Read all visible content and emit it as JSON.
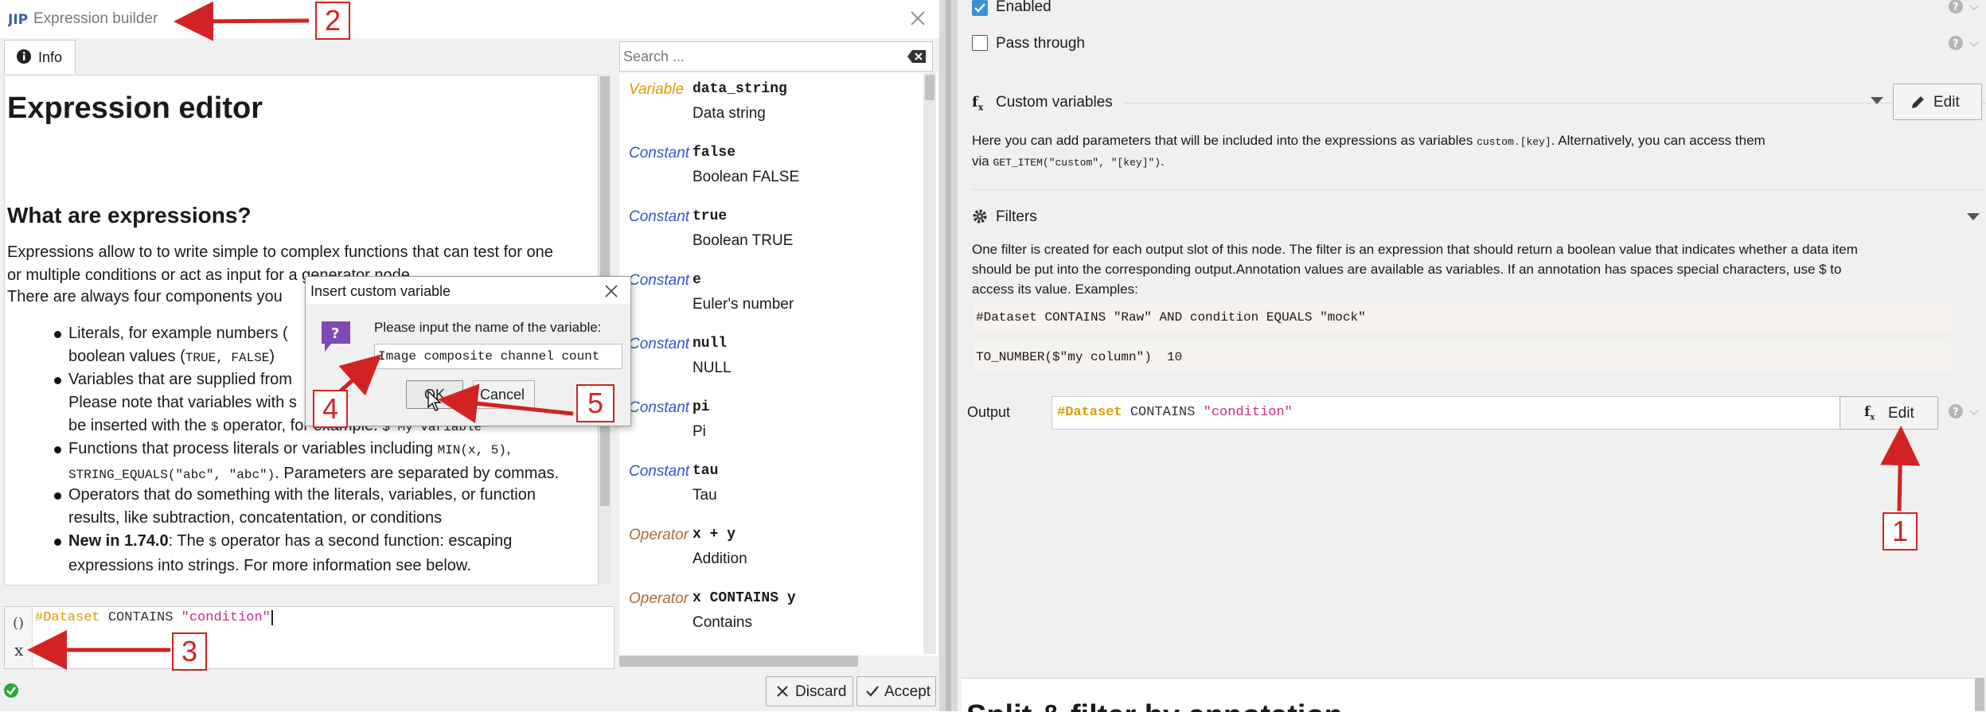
{
  "window": {
    "title": "Expression builder"
  },
  "tab": {
    "label": "Info"
  },
  "doc": {
    "heading": "Expression editor",
    "subheading": "What are expressions?",
    "para1_line1": "Expressions allow to to write simple to complex functions that can test for one",
    "para1_line2": "or multiple conditions or act as input for a generator node.",
    "para2": "There are always four components you",
    "b1_line1": "Literals, for example numbers (",
    "b1_line2_prefix": "boolean values (",
    "b1_line2_code": "TRUE, FALSE",
    "b1_line2_suffix": ")",
    "b2_line1": "Variables that are supplied from",
    "b2_line2": "Please note that variables with s",
    "b2_line3_prefix": "be inserted with the",
    "b2_line3_code": "$",
    "b2_line3_suffix": "operator, for example:",
    "b2_line3_tail": "$\"My variable\"",
    "b3_line1_prefix": "Functions that process literals or variables including",
    "b3_line1_code": "MIN(x, 5)",
    "b3_line1_suffix": ",",
    "b3_line2_code": "STRING_EQUALS(\"abc\", \"abc\")",
    "b3_line2_suffix": ". Parameters are separated by commas.",
    "b4_line1": "Operators that do something with the literals, variables, or function",
    "b4_line2": "results, like subtraction, concatentation, or conditions",
    "b5_bold": "New in 1.74.0",
    "b5_line1_mid": ": The",
    "b5_line1_code": "$",
    "b5_line1_suffix": "operator has a second function: escaping",
    "b5_line2": "expressions into strings. For more information see below."
  },
  "editor": {
    "tok_var": "#Dataset",
    "tok_kw": "CONTAINS",
    "tok_str": "\"condition\"",
    "gutter_top": "()",
    "gutter_bottom": "x"
  },
  "search": {
    "placeholder": "Search ..."
  },
  "items": [
    {
      "kind": "Variable",
      "name": "data_string",
      "desc": "Data string"
    },
    {
      "kind": "Constant",
      "name": "false",
      "desc": "Boolean FALSE"
    },
    {
      "kind": "Constant",
      "name": "true",
      "desc": "Boolean TRUE"
    },
    {
      "kind": "Constant",
      "name": "e",
      "desc": "Euler's number"
    },
    {
      "kind": "Constant",
      "name": "null",
      "desc": "NULL"
    },
    {
      "kind": "Constant",
      "name": "pi",
      "desc": "Pi"
    },
    {
      "kind": "Constant",
      "name": "tau",
      "desc": "Tau"
    },
    {
      "kind": "Operator",
      "name": "x + y",
      "desc": "Addition"
    },
    {
      "kind": "Operator",
      "name": "x CONTAINS y",
      "desc": "Contains"
    }
  ],
  "buttons": {
    "discard": "Discard",
    "accept": "Accept"
  },
  "dialog": {
    "title": "Insert custom variable",
    "prompt": "Please input the name of the variable:",
    "value": "Image composite channel count",
    "ok": "OK",
    "cancel": "Cancel"
  },
  "right": {
    "enabled": "Enabled",
    "pass_through": "Pass through",
    "custom_variables": "Custom variables",
    "edit": "Edit",
    "cv_desc1_prefix": "Here you can add parameters that will be included into the expressions as variables",
    "cv_desc1_code": "custom.[key]",
    "cv_desc1_suffix": ". Alternatively, you can access them",
    "cv_desc2_prefix": "via",
    "cv_desc2_code": "GET_ITEM(\"custom\", \"[key]\")",
    "cv_desc2_suffix": ".",
    "filters": "Filters",
    "filters_desc1": "One filter is created for each output slot of this node. The filter is an expression that should return a boolean value that indicates whether a data item",
    "filters_desc2": "should be put into the corresponding output.Annotation values are available as variables. If an annotation has spaces special characters, use $ to",
    "filters_desc3": "access its value. Examples:",
    "example1": "#Dataset CONTAINS \"Raw\" AND condition EQUALS \"mock\"",
    "example2": "TO_NUMBER($\"my column\")  10",
    "output_label": "Output",
    "output_var": "#Dataset",
    "output_kw": "CONTAINS",
    "output_str": "\"condition\"",
    "output_edit": "Edit",
    "bottom_heading": "Split & filter by annotation"
  },
  "annotations": [
    "1",
    "2",
    "3",
    "4",
    "5"
  ],
  "colors": {
    "annotation": "#d32222",
    "variable": "#e29a00",
    "string": "#cc2a8a",
    "constant": "#3355cc"
  }
}
